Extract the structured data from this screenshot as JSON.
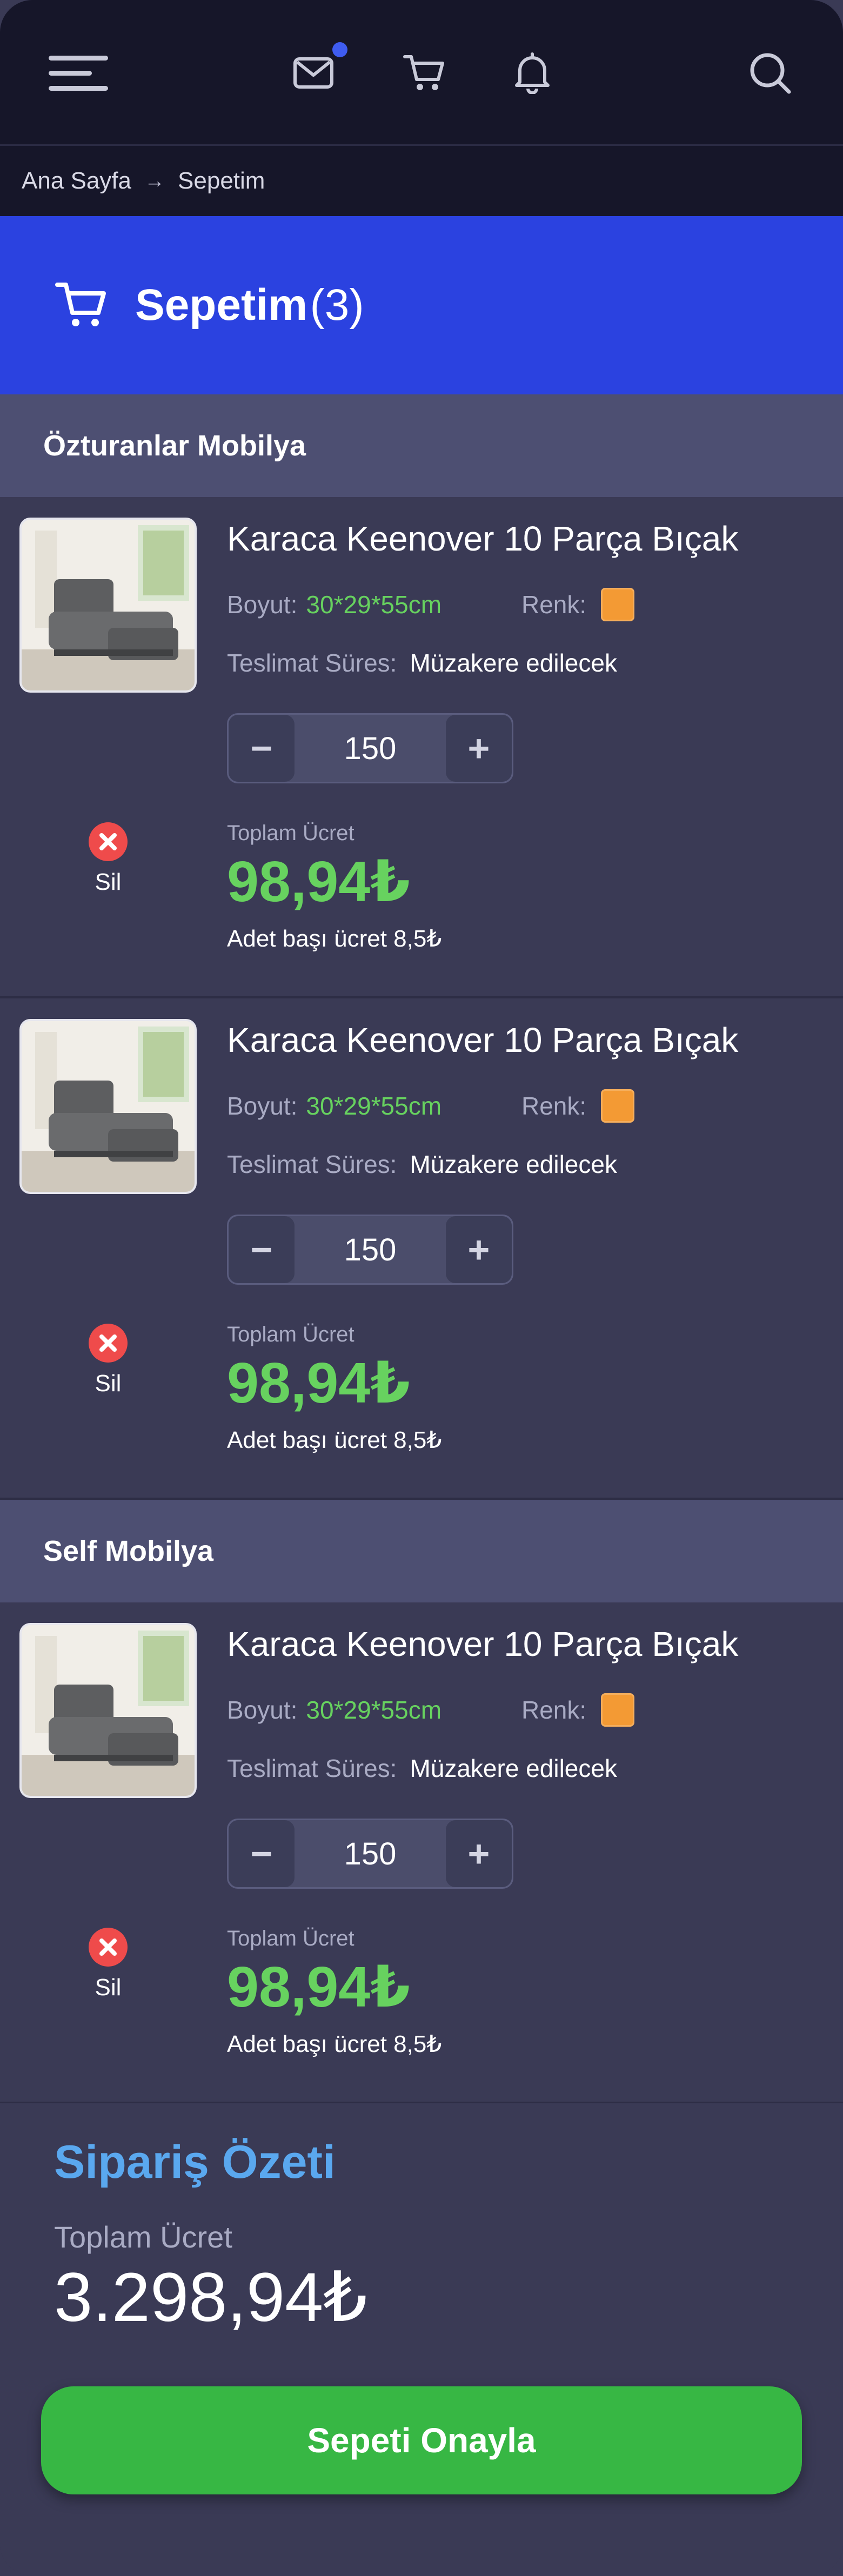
{
  "breadcrumb": {
    "home": "Ana Sayfa",
    "current": "Sepetim"
  },
  "hero": {
    "title": "Sepetim",
    "count": "(3)"
  },
  "shops": [
    {
      "name": "Özturanlar Mobilya",
      "items": [
        {
          "title": "Karaca Keenover 10 Parça Bıçak",
          "size_label": "Boyut:",
          "size_value": "30*29*55cm",
          "color_label": "Renk:",
          "color": "#f39a34",
          "delivery_label": "Teslimat Süres:",
          "delivery_value": "Müzakere edilecek",
          "quantity": "150",
          "remove_label": "Sil",
          "total_label": "Toplam Ücret",
          "total_price": "98,94₺",
          "unit_price": "Adet başı ücret 8,5₺"
        },
        {
          "title": "Karaca Keenover 10 Parça Bıçak",
          "size_label": "Boyut:",
          "size_value": "30*29*55cm",
          "color_label": "Renk:",
          "color": "#f39a34",
          "delivery_label": "Teslimat Süres:",
          "delivery_value": "Müzakere edilecek",
          "quantity": "150",
          "remove_label": "Sil",
          "total_label": "Toplam Ücret",
          "total_price": "98,94₺",
          "unit_price": "Adet başı ücret 8,5₺"
        }
      ]
    },
    {
      "name": "Self Mobilya",
      "items": [
        {
          "title": "Karaca Keenover 10 Parça Bıçak",
          "size_label": "Boyut:",
          "size_value": "30*29*55cm",
          "color_label": "Renk:",
          "color": "#f39a34",
          "delivery_label": "Teslimat Süres:",
          "delivery_value": "Müzakere edilecek",
          "quantity": "150",
          "remove_label": "Sil",
          "total_label": "Toplam Ücret",
          "total_price": "98,94₺",
          "unit_price": "Adet başı ücret 8,5₺"
        }
      ]
    }
  ],
  "summary": {
    "title": "Sipariş Özeti",
    "total_label": "Toplam Ücret",
    "total_value": "3.298,94₺",
    "confirm_label": "Sepeti Onayla"
  },
  "colors": {
    "accent": "#2b42e0",
    "price": "#67d25f",
    "confirm": "#37b744",
    "summary_title": "#5aa8ef"
  },
  "icons": [
    "menu-icon",
    "mail-icon",
    "cart-icon",
    "bell-icon",
    "search-icon",
    "remove-icon"
  ]
}
